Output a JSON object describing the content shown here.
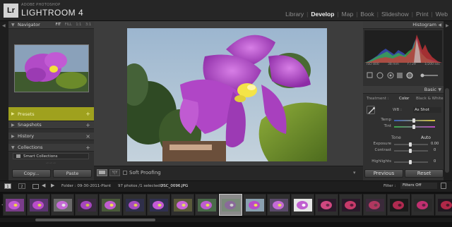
{
  "app": {
    "logo_text": "Lr",
    "brand_small": "ADOBE PHOTOSHOP",
    "brand_name": "LIGHTROOM 4"
  },
  "modules": [
    {
      "label": "Library",
      "active": false
    },
    {
      "label": "Develop",
      "active": true
    },
    {
      "label": "Map",
      "active": false
    },
    {
      "label": "Book",
      "active": false
    },
    {
      "label": "Slideshow",
      "active": false
    },
    {
      "label": "Print",
      "active": false
    },
    {
      "label": "Web",
      "active": false
    }
  ],
  "left_panel": {
    "navigator_title": "Navigator",
    "zoom_options": [
      "FIT",
      "FILL",
      "1:1",
      "3:1"
    ],
    "presets_title": "Presets",
    "snapshots_title": "Snapshots",
    "history_title": "History",
    "collections_title": "Collections",
    "smart_collections": "Smart Collections",
    "copy_label": "Copy...",
    "paste_label": "Paste"
  },
  "toolbar": {
    "view_compare_label": "Y|Y",
    "soft_proofing_label": "Soft Proofing",
    "soft_proofing_checked": false
  },
  "right_panel": {
    "histogram_title": "Histogram",
    "hist_info": [
      "ISO 800",
      "38 mm",
      "f / 29",
      "1/200 sec"
    ],
    "basic_title": "Basic",
    "treatment_label": "Treatment :",
    "treatment_color": "Color",
    "treatment_bw": "Black & White",
    "wb_label": "WB :",
    "wb_value": "As Shot",
    "temp_label": "Temp",
    "tint_label": "Tint",
    "tone_label": "Tone",
    "tone_auto": "Auto",
    "exposure_label": "Exposure",
    "exposure_value": "0.00",
    "contrast_label": "Contrast",
    "contrast_value": "0",
    "highlights_label": "Highlights",
    "highlights_value": "0",
    "previous_label": "Previous",
    "reset_label": "Reset"
  },
  "filmstrip": {
    "num1": "1",
    "num2": "2",
    "folder": "Folder : 09-30-2011-Plant",
    "count": "97 photos /1 selected /",
    "filename": "DSC_0096.JPG",
    "filter_label": "Filter :",
    "filter_value": "Filters Off",
    "thumbnail_count": 19,
    "selected_index": 9
  },
  "colors": {
    "presets_highlight": "#9fa11e",
    "orchid": "#b04ac8",
    "panel_bg": "#303030"
  }
}
